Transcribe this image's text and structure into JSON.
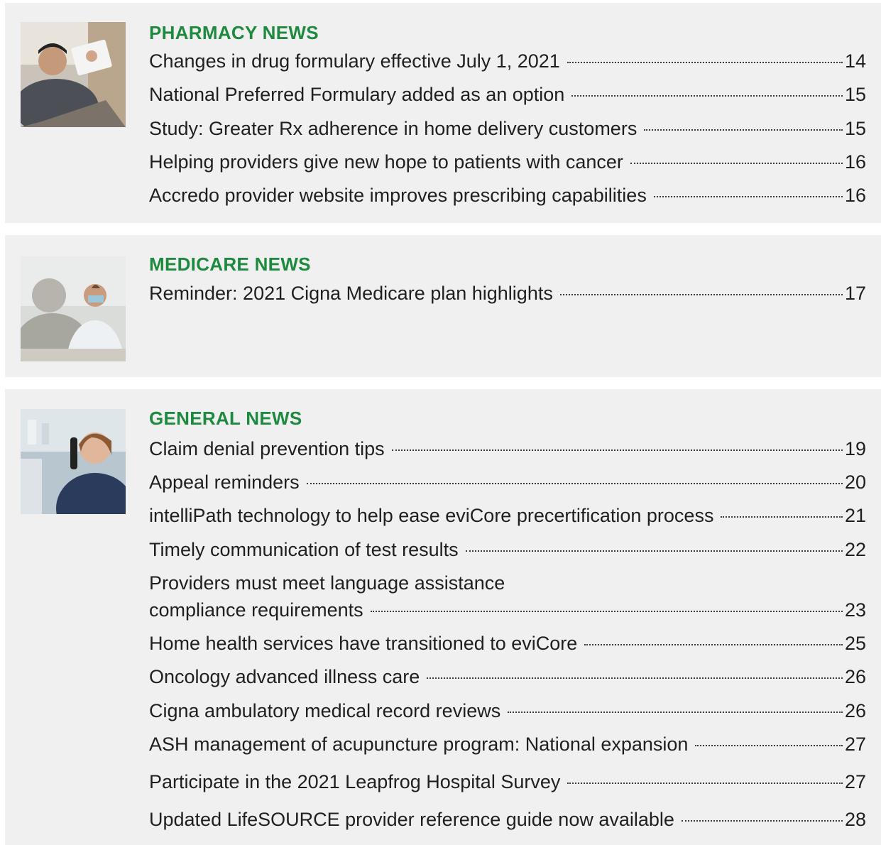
{
  "accent_color": "#1d8a3f",
  "pharmacy": {
    "heading": "PHARMACY NEWS",
    "items": [
      {
        "title": "Changes in drug formulary effective July 1, 2021",
        "page": "14"
      },
      {
        "title": "National Preferred Formulary added as an option",
        "page": "15"
      },
      {
        "title": "Study: Greater Rx adherence in home delivery customers",
        "page": "15"
      },
      {
        "title": "Helping providers give new hope to patients with cancer",
        "page": "16"
      },
      {
        "title": "Accredo provider website improves prescribing capabilities",
        "page": "16"
      }
    ]
  },
  "medicare": {
    "heading": "MEDICARE NEWS",
    "items": [
      {
        "title": "Reminder: 2021 Cigna Medicare plan highlights",
        "page": "17"
      }
    ]
  },
  "general": {
    "heading": "GENERAL NEWS",
    "items": [
      {
        "title": "Claim denial prevention tips",
        "page": "19"
      },
      {
        "title": "Appeal reminders",
        "page": "20"
      },
      {
        "title": "intelliPath technology to help ease eviCore precertification process",
        "page": "21"
      },
      {
        "title": "Timely communication of test results",
        "page": "22"
      },
      {
        "title_line1": "Providers must meet language assistance",
        "title": "compliance requirements",
        "page": "23"
      },
      {
        "title": "Home health services have transitioned to eviCore",
        "page": "25"
      },
      {
        "title": "Oncology advanced illness care",
        "page": "26"
      },
      {
        "title": "Cigna ambulatory medical record reviews",
        "page": "26"
      },
      {
        "title": "ASH management of acupuncture program: National expansion",
        "page": "27"
      },
      {
        "title": "Participate in the 2021 Leapfrog Hospital Survey",
        "page": "27"
      },
      {
        "title": "Updated LifeSOURCE provider reference guide now available",
        "page": "28"
      }
    ]
  }
}
